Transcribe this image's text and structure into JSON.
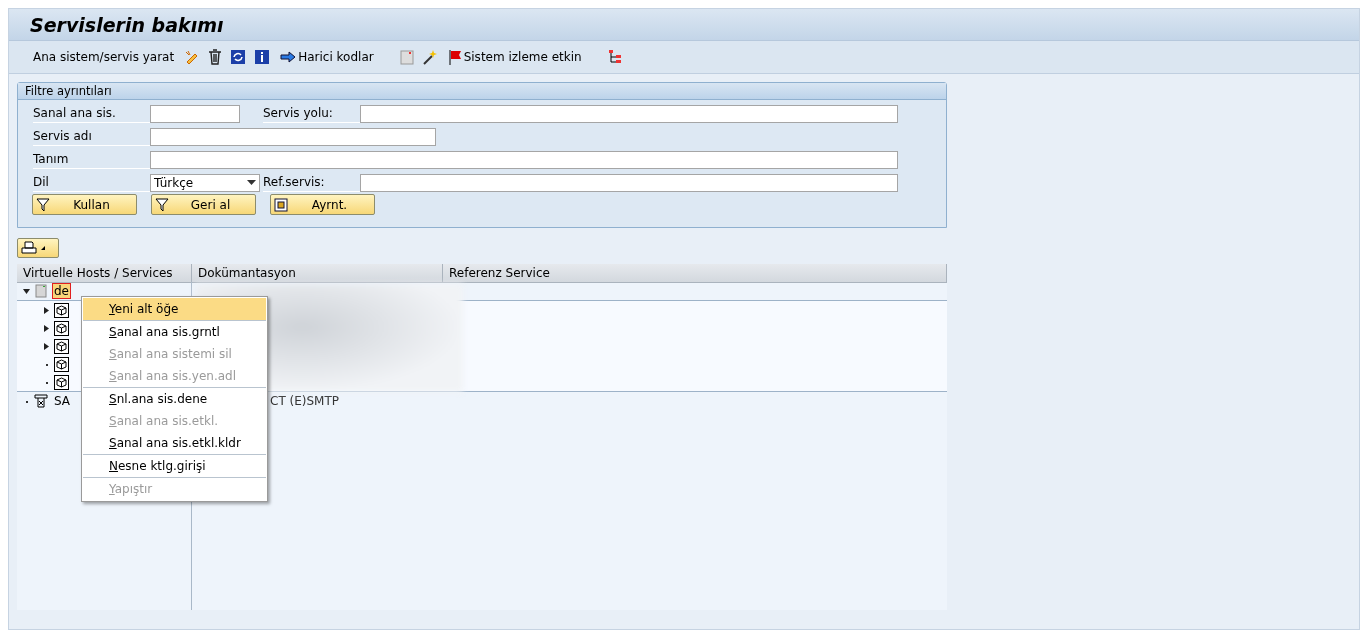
{
  "window": {
    "title": "Servislerin bakımı"
  },
  "toolbar": {
    "create_label": "Ana sistem/servis yarat",
    "external_codes": "Harici kodlar",
    "monitoring": "Sistem izleme etkin"
  },
  "filter": {
    "title": "Filtre ayrıntıları",
    "fields": [
      {
        "label": "Sanal ana sis."
      },
      {
        "label": "Servis yolu:"
      },
      {
        "label": "Servis adı"
      },
      {
        "label": "Tanım"
      },
      {
        "label": "Dil",
        "value": "Türkçe"
      },
      {
        "label": "Ref.servis:"
      }
    ],
    "buttons": [
      "Kullan",
      "Geri al",
      "Ayrnt."
    ]
  },
  "tree": {
    "columns": [
      "Virtuelle Hosts / Services",
      "Dokümantasyon",
      "Referenz Service"
    ],
    "rows": [
      {
        "name": "de",
        "expanded": true,
        "selected": true,
        "children": [
          {
            "expanded": false
          },
          {
            "expanded": false
          },
          {
            "expanded": false
          },
          {
            "leaf": true
          },
          {
            "leaf": true
          }
        ]
      },
      {
        "name": "SA",
        "documentation": "CT (E)SMTP",
        "leaf": true
      }
    ]
  },
  "context_menu": [
    {
      "kind": "item",
      "label": "Yeni alt öğe",
      "disabled": false,
      "selected": true
    },
    {
      "kind": "separator"
    },
    {
      "kind": "item",
      "label": "Sanal ana sis.grntl",
      "disabled": false,
      "selected": false
    },
    {
      "kind": "item",
      "label": "Sanal ana sistemi sil",
      "disabled": true,
      "selected": false
    },
    {
      "kind": "item",
      "label": "Sanal ana sis.yen.adl",
      "disabled": true,
      "selected": false
    },
    {
      "kind": "separator"
    },
    {
      "kind": "item",
      "label": "Snl.ana sis.dene",
      "disabled": false,
      "selected": false
    },
    {
      "kind": "item",
      "label": "Sanal ana sis.etkl.",
      "disabled": true,
      "selected": false
    },
    {
      "kind": "item",
      "label": "Sanal ana sis.etkl.kldr",
      "disabled": false,
      "selected": false
    },
    {
      "kind": "separator"
    },
    {
      "kind": "item",
      "label": "Nesne ktlg.girişi",
      "disabled": false,
      "selected": false
    },
    {
      "kind": "separator"
    },
    {
      "kind": "item",
      "label": "Yapıştır",
      "disabled": true,
      "selected": false
    }
  ]
}
